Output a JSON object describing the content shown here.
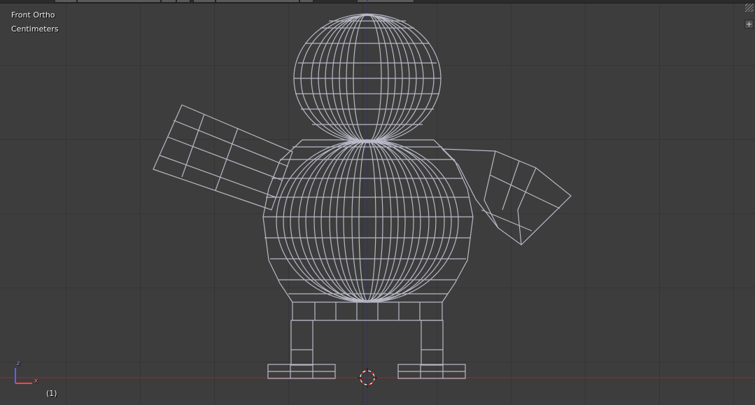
{
  "viewport": {
    "view_label": "Front Ortho",
    "units_label": "Centimeters",
    "frame_label": "(1)"
  },
  "axis_gizmo": {
    "up_axis": "z",
    "right_axis": "x"
  },
  "colors": {
    "background": "#3d3d3d",
    "grid": "#353535",
    "wireframe": "#b9b9c7",
    "x_axis_line": "#9a2a2a",
    "z_axis_line": "#2a2a9a"
  },
  "icons": {
    "corner_add": "plus-icon",
    "corner_split": "area-split-hatch-icon",
    "cursor": "3d-cursor-icon"
  }
}
